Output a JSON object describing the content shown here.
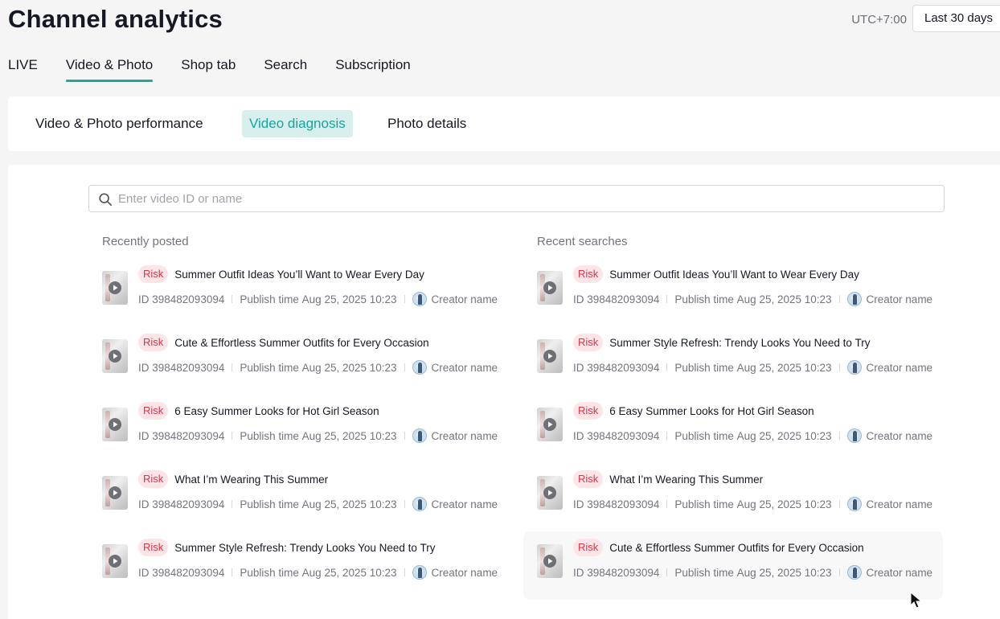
{
  "header": {
    "title": "Channel analytics",
    "timezone": "UTC+7:00",
    "date_range": "Last 30 days"
  },
  "main_tabs": [
    {
      "label": "LIVE",
      "active": false
    },
    {
      "label": "Video & Photo",
      "active": true
    },
    {
      "label": "Shop tab",
      "active": false
    },
    {
      "label": "Search",
      "active": false
    },
    {
      "label": "Subscription",
      "active": false
    }
  ],
  "sub_tabs": [
    {
      "label": "Video & Photo performance",
      "active": false
    },
    {
      "label": "Video diagnosis",
      "active": true
    },
    {
      "label": "Photo details",
      "active": false
    }
  ],
  "search": {
    "placeholder": "Enter video ID or name",
    "value": ""
  },
  "recently_posted": {
    "title": "Recently posted",
    "items": [
      {
        "badge": "Risk",
        "title": "Summer Outfit Ideas You’ll Want to Wear Every Day",
        "id": "ID 398482093094",
        "publish_label": "Publish time",
        "publish_time": "Aug 25, 2025 10:23",
        "creator": "Creator name"
      },
      {
        "badge": "Risk",
        "title": "Cute & Effortless Summer Outfits for Every Occasion",
        "id": "ID 398482093094",
        "publish_label": "Publish time",
        "publish_time": "Aug 25, 2025 10:23",
        "creator": "Creator name"
      },
      {
        "badge": "Risk",
        "title": "6 Easy Summer Looks for Hot Girl Season",
        "id": "ID 398482093094",
        "publish_label": "Publish time",
        "publish_time": "Aug 25, 2025 10:23",
        "creator": "Creator name"
      },
      {
        "badge": "Risk",
        "title": "What I’m Wearing This Summer",
        "id": "ID 398482093094",
        "publish_label": "Publish time",
        "publish_time": "Aug 25, 2025 10:23",
        "creator": "Creator name"
      },
      {
        "badge": "Risk",
        "title": "Summer Style Refresh: Trendy Looks You Need to Try",
        "id": "ID 398482093094",
        "publish_label": "Publish time",
        "publish_time": "Aug 25, 2025 10:23",
        "creator": "Creator name"
      }
    ]
  },
  "recent_searches": {
    "title": "Recent searches",
    "items": [
      {
        "badge": "Risk",
        "title": "Summer Outfit Ideas You’ll Want to Wear Every Day",
        "id": "ID 398482093094",
        "publish_label": "Publish time",
        "publish_time": "Aug 25, 2025 10:23",
        "creator": "Creator name"
      },
      {
        "badge": "Risk",
        "title": "Summer Style Refresh: Trendy Looks You Need to Try",
        "id": "ID 398482093094",
        "publish_label": "Publish time",
        "publish_time": "Aug 25, 2025 10:23",
        "creator": "Creator name"
      },
      {
        "badge": "Risk",
        "title": "6 Easy Summer Looks for Hot Girl Season",
        "id": "ID 398482093094",
        "publish_label": "Publish time",
        "publish_time": "Aug 25, 2025 10:23",
        "creator": "Creator name"
      },
      {
        "badge": "Risk",
        "title": "What I’m Wearing This Summer",
        "id": "ID 398482093094",
        "publish_label": "Publish time",
        "publish_time": "Aug 25, 2025 10:23",
        "creator": "Creator name"
      },
      {
        "badge": "Risk",
        "title": "Cute & Effortless Summer Outfits for Every Occasion",
        "id": "ID 398482093094",
        "publish_label": "Publish time",
        "publish_time": "Aug 25, 2025 10:23",
        "creator": "Creator name"
      }
    ]
  },
  "colors": {
    "accent": "#1fa8a0",
    "accent_bg": "#d8efee",
    "risk_text": "#d8354a",
    "risk_bg": "#fde4e6"
  },
  "icons": {
    "search": "search-icon",
    "play": "play-icon",
    "avatar": "avatar",
    "cursor": "cursor-icon"
  }
}
